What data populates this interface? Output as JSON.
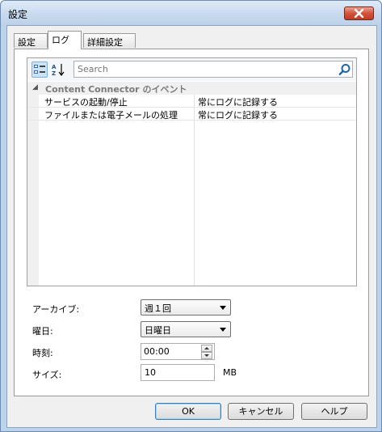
{
  "window": {
    "title": "設定"
  },
  "tabs": [
    {
      "label": "設定",
      "active": false
    },
    {
      "label": "ログ",
      "active": true
    },
    {
      "label": "詳細設定",
      "active": false
    }
  ],
  "property_grid": {
    "search_placeholder": "Search",
    "category": "Content Connector のイベント",
    "rows": [
      {
        "name": "サービスの起動/停止",
        "value": "常にログに記録する"
      },
      {
        "name": "ファイルまたは電子メールの処理",
        "value": "常にログに記録する"
      }
    ]
  },
  "form": {
    "archive": {
      "label": "アーカイブ:",
      "value": "週１回"
    },
    "weekday": {
      "label": "曜日:",
      "value": "日曜日"
    },
    "time": {
      "label": "時刻:",
      "value": "00:00"
    },
    "size": {
      "label": "サイズ:",
      "value": "10",
      "unit": "MB"
    }
  },
  "buttons": {
    "ok": "OK",
    "cancel": "キャンセル",
    "help": "ヘルプ"
  },
  "colors": {
    "close_button": "#c8432a",
    "accent": "#3c7fb1",
    "selected_tool": "#cde4f7"
  }
}
